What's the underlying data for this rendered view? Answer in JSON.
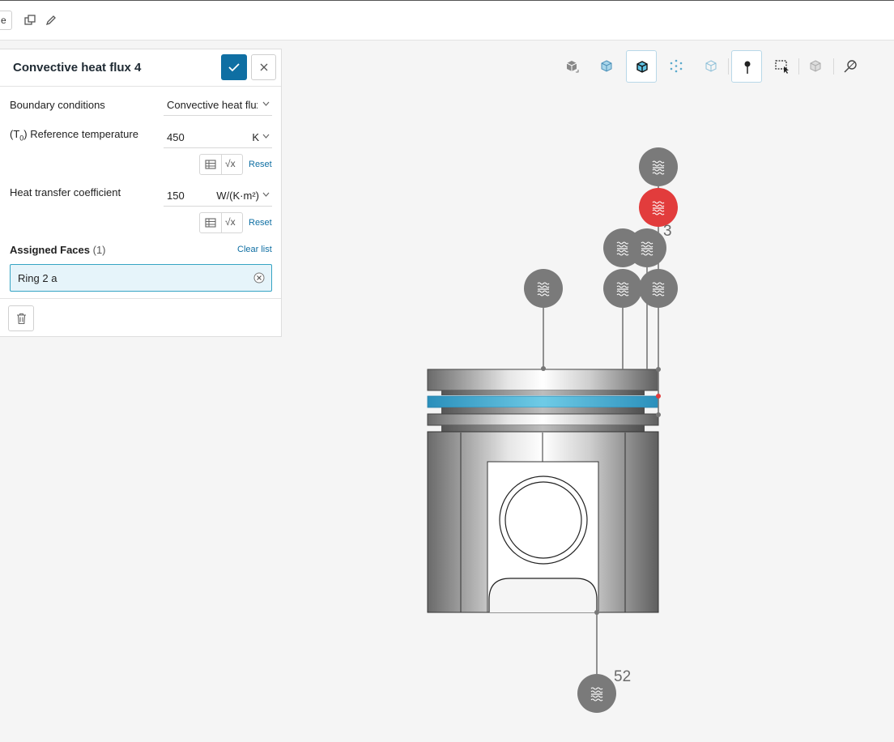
{
  "toolbar": {
    "cut_button_label": "e",
    "icons": [
      "duplicate-icon",
      "edit-pencil-icon"
    ]
  },
  "panel": {
    "title": "Convective heat flux 4",
    "confirm_icon": "check-icon",
    "close_icon": "close-icon",
    "boundary_conditions": {
      "label": "Boundary conditions",
      "value": "Convective heat flux"
    },
    "reference_temperature": {
      "label_prefix": "(T",
      "label_sub": "0",
      "label_suffix": ") Reference temperature",
      "value": "450",
      "unit": "K",
      "reset": "Reset"
    },
    "heat_transfer": {
      "label": "Heat transfer coefficient",
      "value": "150",
      "unit": "W/(K·m²)",
      "reset": "Reset"
    },
    "assigned_faces": {
      "title": "Assigned Faces",
      "count": "(1)",
      "clear": "Clear list",
      "items": [
        "Ring 2 a"
      ]
    }
  },
  "viewport_toolbar": {
    "tools": [
      {
        "icon": "solid-view-icon",
        "active": false
      },
      {
        "icon": "transparent-view-icon",
        "active": false
      },
      {
        "icon": "solid-edges-view-icon",
        "active": true
      },
      {
        "icon": "points-view-icon",
        "active": false
      },
      {
        "icon": "wireframe-view-icon",
        "active": false
      },
      {
        "icon": "pin-icon",
        "active": true
      },
      {
        "icon": "box-select-icon",
        "active": false
      },
      {
        "icon": "hide-parts-icon",
        "active": false
      },
      {
        "icon": "pointer-settings-icon",
        "active": false
      }
    ]
  },
  "viewport": {
    "pin_labels": {
      "top_cluster": "3",
      "bottom": "52"
    },
    "colors": {
      "selected_face": "#3aa6cc",
      "pin_gray": "#7a7a7a",
      "pin_selected": "#e23c3c",
      "accent": "#0f6fa3"
    }
  }
}
